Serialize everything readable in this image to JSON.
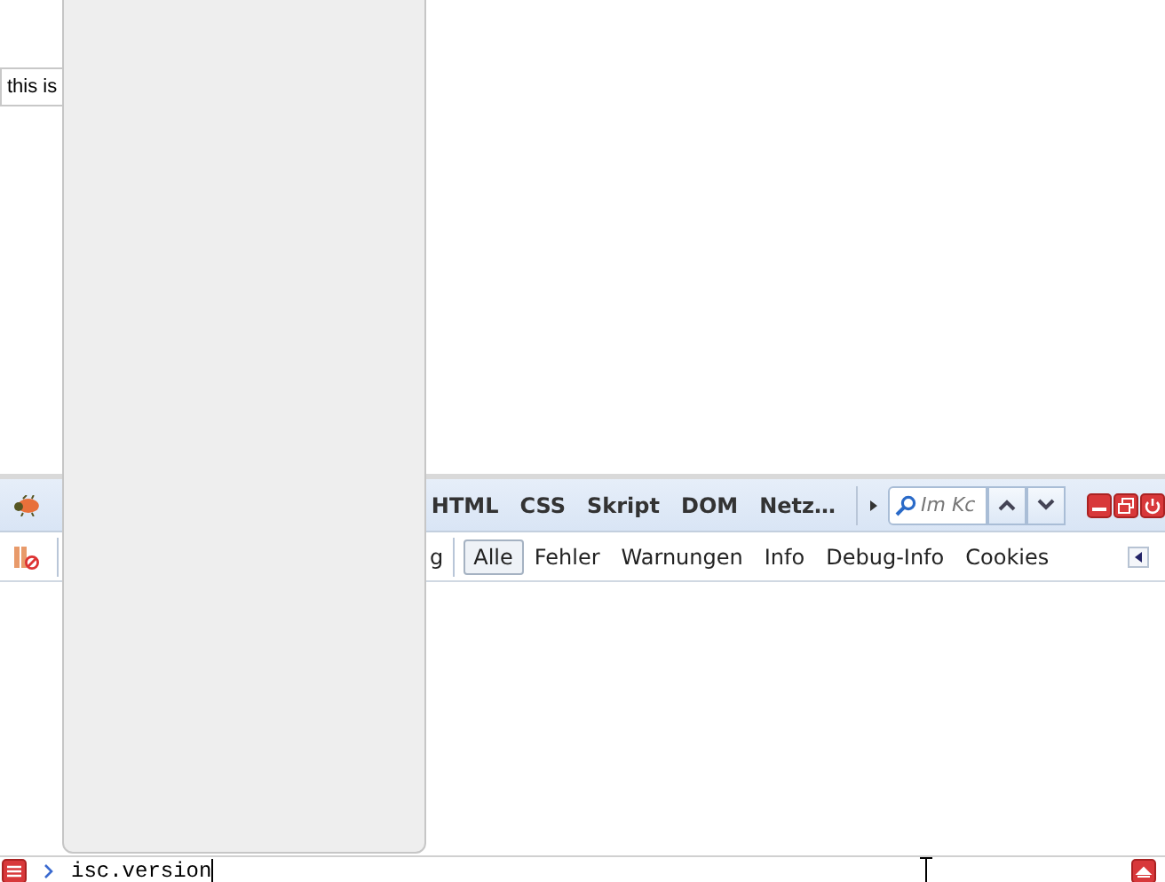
{
  "page": {
    "text_field": {
      "value": "this is"
    }
  },
  "toolbar": {
    "tabs": [
      {
        "label": "HTML",
        "selected": false
      },
      {
        "label": "CSS",
        "selected": false
      },
      {
        "label": "Skript",
        "selected": false
      },
      {
        "label": "DOM",
        "selected": false
      },
      {
        "label": "Netz…",
        "selected": false
      }
    ],
    "search": {
      "placeholder": "Im Kc"
    }
  },
  "console_toolbar": {
    "clipped_label": "g",
    "filters": [
      {
        "label": "Alle",
        "selected": true
      },
      {
        "label": "Fehler",
        "selected": false
      },
      {
        "label": "Warnungen",
        "selected": false
      },
      {
        "label": "Info",
        "selected": false
      },
      {
        "label": "Debug-Info",
        "selected": false
      },
      {
        "label": "Cookies",
        "selected": false
      }
    ]
  },
  "command_line": {
    "value": "isc.version"
  }
}
